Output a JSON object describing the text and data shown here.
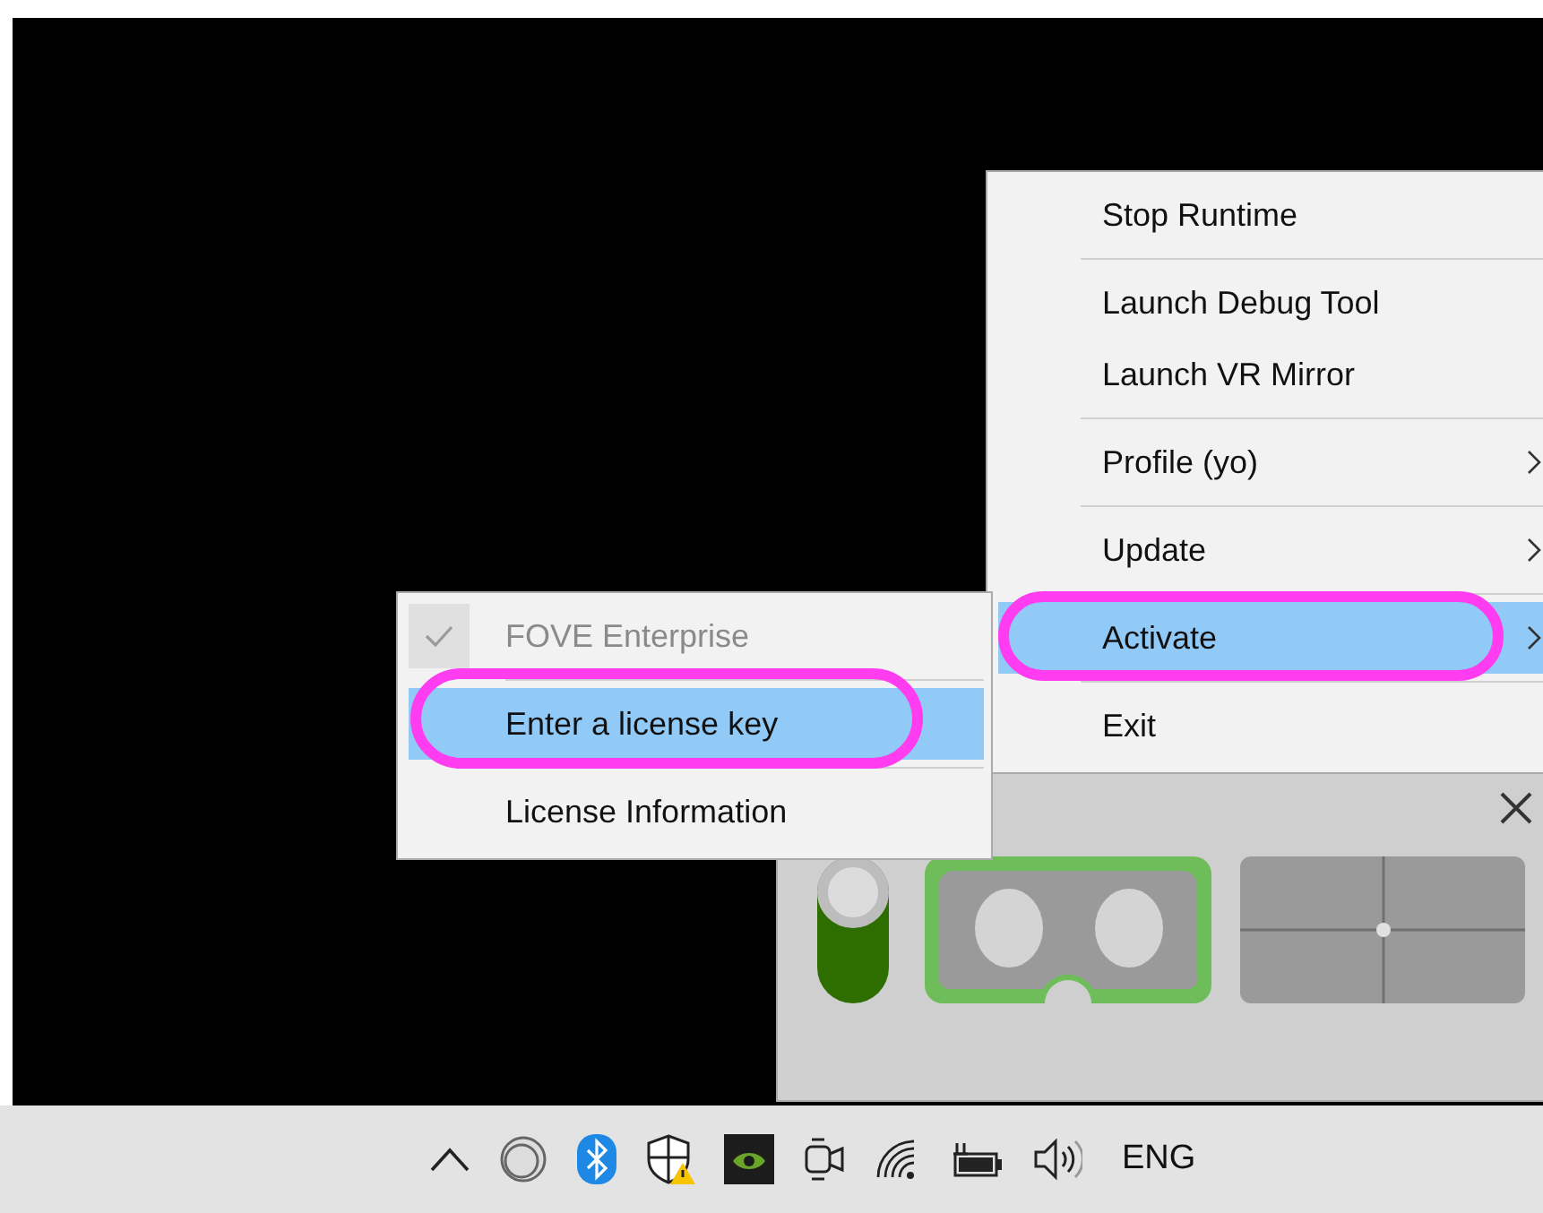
{
  "main_menu": {
    "groups": [
      {
        "items": [
          {
            "label": "Stop Runtime",
            "has_submenu": false,
            "selected": false,
            "circled": false
          }
        ]
      },
      {
        "items": [
          {
            "label": "Launch Debug Tool",
            "has_submenu": false,
            "selected": false,
            "circled": false
          },
          {
            "label": "Launch VR Mirror",
            "has_submenu": false,
            "selected": false,
            "circled": false
          }
        ]
      },
      {
        "items": [
          {
            "label": "Profile (yo)",
            "has_submenu": true,
            "selected": false,
            "circled": false
          }
        ]
      },
      {
        "items": [
          {
            "label": "Update",
            "has_submenu": true,
            "selected": false,
            "circled": false
          }
        ]
      },
      {
        "items": [
          {
            "label": "Activate",
            "has_submenu": true,
            "selected": true,
            "circled": true
          }
        ]
      },
      {
        "items": [
          {
            "label": "Exit",
            "has_submenu": false,
            "selected": false,
            "circled": false
          }
        ]
      }
    ]
  },
  "submenu": {
    "groups": [
      {
        "items": [
          {
            "label": "FOVE Enterprise",
            "checked": true,
            "disabled": true,
            "selected": false,
            "circled": false
          }
        ]
      },
      {
        "items": [
          {
            "label": "Enter a license key",
            "checked": false,
            "disabled": false,
            "selected": true,
            "circled": true
          }
        ]
      },
      {
        "items": [
          {
            "label": "License Information",
            "checked": false,
            "disabled": false,
            "selected": false,
            "circled": false
          }
        ]
      }
    ]
  },
  "panel": {
    "switch": {
      "on": true
    }
  },
  "taskbar": {
    "icons": [
      {
        "kind": "caret"
      },
      {
        "kind": "ring"
      },
      {
        "kind": "bluetooth"
      },
      {
        "kind": "shield"
      },
      {
        "kind": "gpu"
      },
      {
        "kind": "camera"
      },
      {
        "kind": "wifi"
      },
      {
        "kind": "battery"
      },
      {
        "kind": "volume"
      }
    ],
    "language": "ENG"
  }
}
